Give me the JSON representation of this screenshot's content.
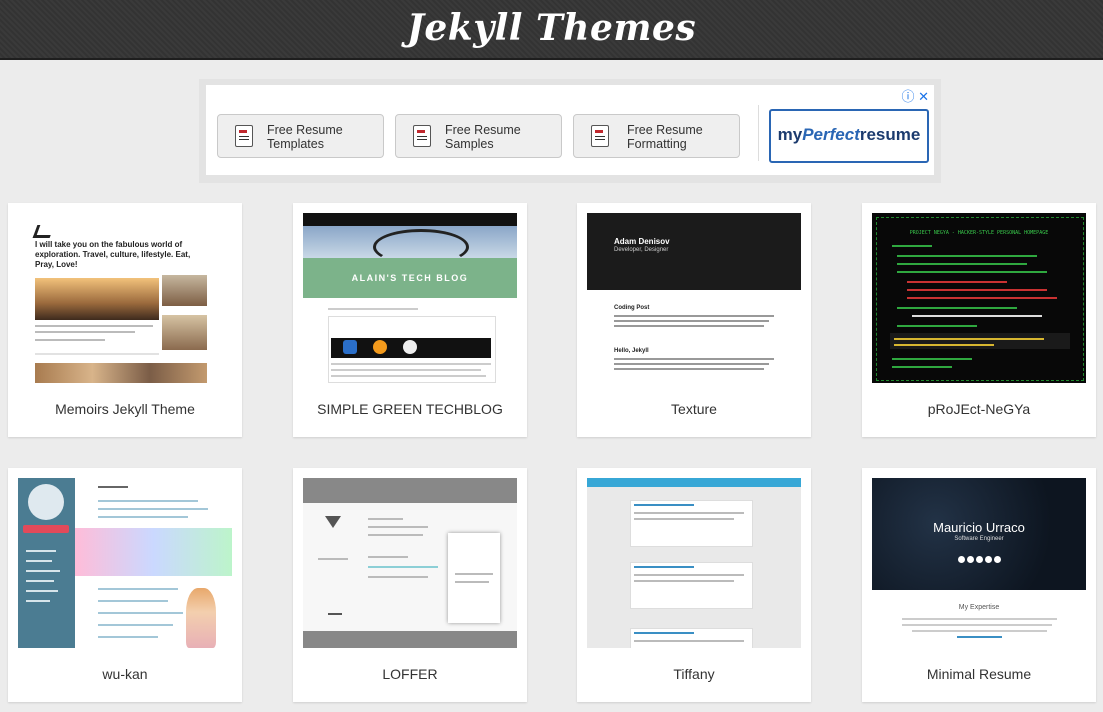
{
  "site": {
    "title": "Jekyll Themes"
  },
  "ad": {
    "buttons": [
      {
        "line1": "Free Resume",
        "line2": "Templates"
      },
      {
        "line1": "Free Resume",
        "line2": "Samples"
      },
      {
        "line1": "Free Resume",
        "line2": "Formatting"
      }
    ],
    "logo": {
      "my": "my",
      "perfect": "Perfect",
      "resume": "resume"
    },
    "info_glyph": "ⓘ",
    "close_glyph": "✕"
  },
  "themes": [
    {
      "name": "Memoirs Jekyll Theme",
      "preview": {
        "headline": "I will take you on the fabulous world of exploration. Travel, culture, lifestyle. Eat, Pray, Love!"
      }
    },
    {
      "name": "SIMPLE GREEN TECHBLOG",
      "preview": {
        "banner": "ALAIN'S TECH BLOG"
      }
    },
    {
      "name": "Texture",
      "preview": {
        "author": "Adam Denisov",
        "role": "Developer, Designer",
        "post1": "Coding Post",
        "post2": "Hello, Jekyll"
      }
    },
    {
      "name": "pRoJEct-NeGYa",
      "preview": {
        "header": "PROJECT NEGYA - HACKER-STYLE PERSONAL HOMEPAGE"
      }
    },
    {
      "name": "wu-kan",
      "preview": {}
    },
    {
      "name": "LOFFER",
      "preview": {}
    },
    {
      "name": "Tiffany",
      "preview": {}
    },
    {
      "name": "Minimal Resume",
      "preview": {
        "person": "Mauricio Urraco",
        "role": "Software Engineer",
        "section": "My Expertise"
      }
    }
  ]
}
